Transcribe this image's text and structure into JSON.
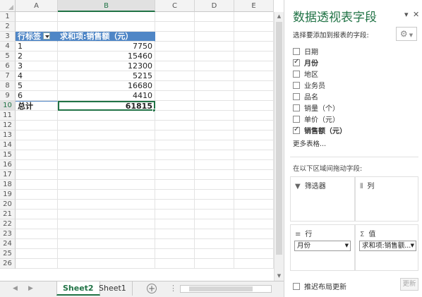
{
  "sheet": {
    "columns": [
      "A",
      "B",
      "C",
      "D",
      "E"
    ],
    "row_numbers": [
      "1",
      "2",
      "3",
      "4",
      "5",
      "6",
      "7",
      "8",
      "9",
      "10",
      "11",
      "12",
      "13",
      "14",
      "15",
      "16",
      "17",
      "18",
      "19",
      "20",
      "21",
      "22",
      "23",
      "24",
      "25",
      "26"
    ],
    "pivot_header": {
      "row_label": "行标签",
      "value_label": "求和项:销售额（元）"
    },
    "pivot_rows": [
      {
        "label": "1",
        "value": "7750"
      },
      {
        "label": "2",
        "value": "15460"
      },
      {
        "label": "3",
        "value": "12300"
      },
      {
        "label": "4",
        "value": "5215"
      },
      {
        "label": "5",
        "value": "16680"
      },
      {
        "label": "6",
        "value": "4410"
      }
    ],
    "total": {
      "label": "总计",
      "value": "61815"
    },
    "tabs": [
      {
        "label": "Sheet2"
      },
      {
        "label": "Sheet1"
      }
    ],
    "add_sheet": "+",
    "dots": "⋮"
  },
  "pivot_panel": {
    "title": "数据透视表字段",
    "dropdown_glyph": "▾",
    "close_glyph": "✕",
    "subtitle": "选择要添加到报表的字段:",
    "gear": "⚙",
    "fields": [
      {
        "label": "日期",
        "checked": false
      },
      {
        "label": "月份",
        "checked": true
      },
      {
        "label": "地区",
        "checked": false
      },
      {
        "label": "业务员",
        "checked": false
      },
      {
        "label": "品名",
        "checked": false
      },
      {
        "label": "销量（个）",
        "checked": false
      },
      {
        "label": "单价（元）",
        "checked": false
      },
      {
        "label": "销售额（元）",
        "checked": true
      }
    ],
    "more_tables": "更多表格...",
    "drag_label": "在以下区域间拖动字段:",
    "areas": {
      "filters": {
        "label": "筛选器",
        "icon": "▼"
      },
      "columns": {
        "label": "列",
        "icon": "⦀"
      },
      "rows": {
        "label": "行",
        "icon": "≡",
        "item": "月份"
      },
      "values": {
        "label": "值",
        "icon": "Σ",
        "item": "求和项:销售额..."
      }
    },
    "defer_label": "推迟布局更新",
    "update_label": "更新"
  },
  "colors": {
    "accent": "#217346",
    "pivot_header": "#4f86c6"
  }
}
